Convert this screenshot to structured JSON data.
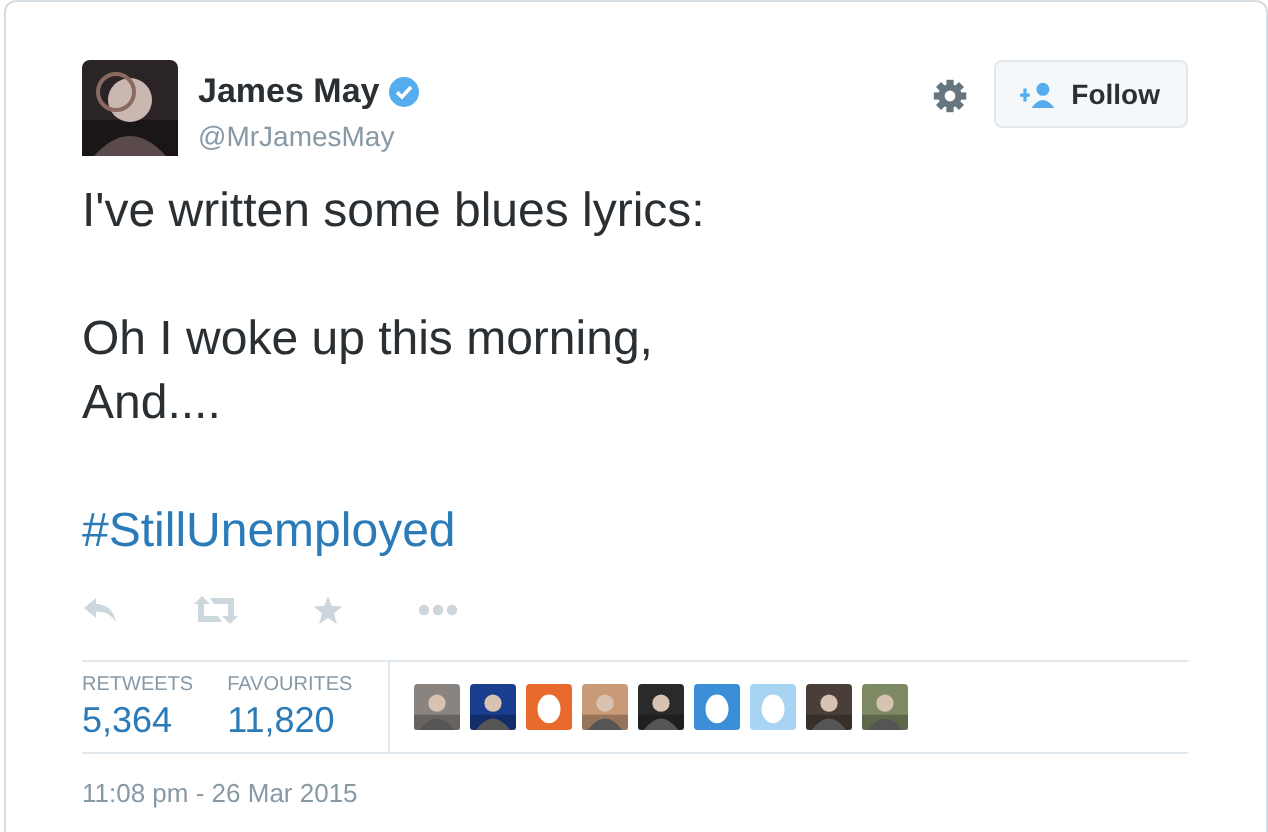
{
  "author": {
    "name": "James May",
    "verified": true,
    "handle": "@MrJamesMay"
  },
  "follow_button": {
    "label": "Follow"
  },
  "tweet": [
    {
      "kind": "text",
      "lines": [
        "I've written some blues lyrics:"
      ]
    },
    {
      "kind": "text",
      "lines": [
        "Oh I woke up this morning,",
        "And...."
      ]
    },
    {
      "kind": "hashtag",
      "lines": [
        "#StillUnemployed"
      ]
    }
  ],
  "stats": [
    {
      "label": "RETWEETS",
      "value": "5,364"
    },
    {
      "label": "FAVOURITES",
      "value": "11,820"
    }
  ],
  "favouriters": [
    {
      "kind": "picture",
      "color": "#8a8480"
    },
    {
      "kind": "picture",
      "color": "#1a3d8f"
    },
    {
      "kind": "egg",
      "color": "#e8692c"
    },
    {
      "kind": "picture",
      "color": "#c99a78"
    },
    {
      "kind": "picture",
      "color": "#2a2a2a"
    },
    {
      "kind": "egg",
      "color": "#3b8fd9"
    },
    {
      "kind": "egg",
      "color": "#a6d4f2"
    },
    {
      "kind": "picture",
      "color": "#4a3f38"
    },
    {
      "kind": "picture",
      "color": "#7e8a63"
    }
  ],
  "timestamp": "11:08 pm - 26 Mar 2015"
}
